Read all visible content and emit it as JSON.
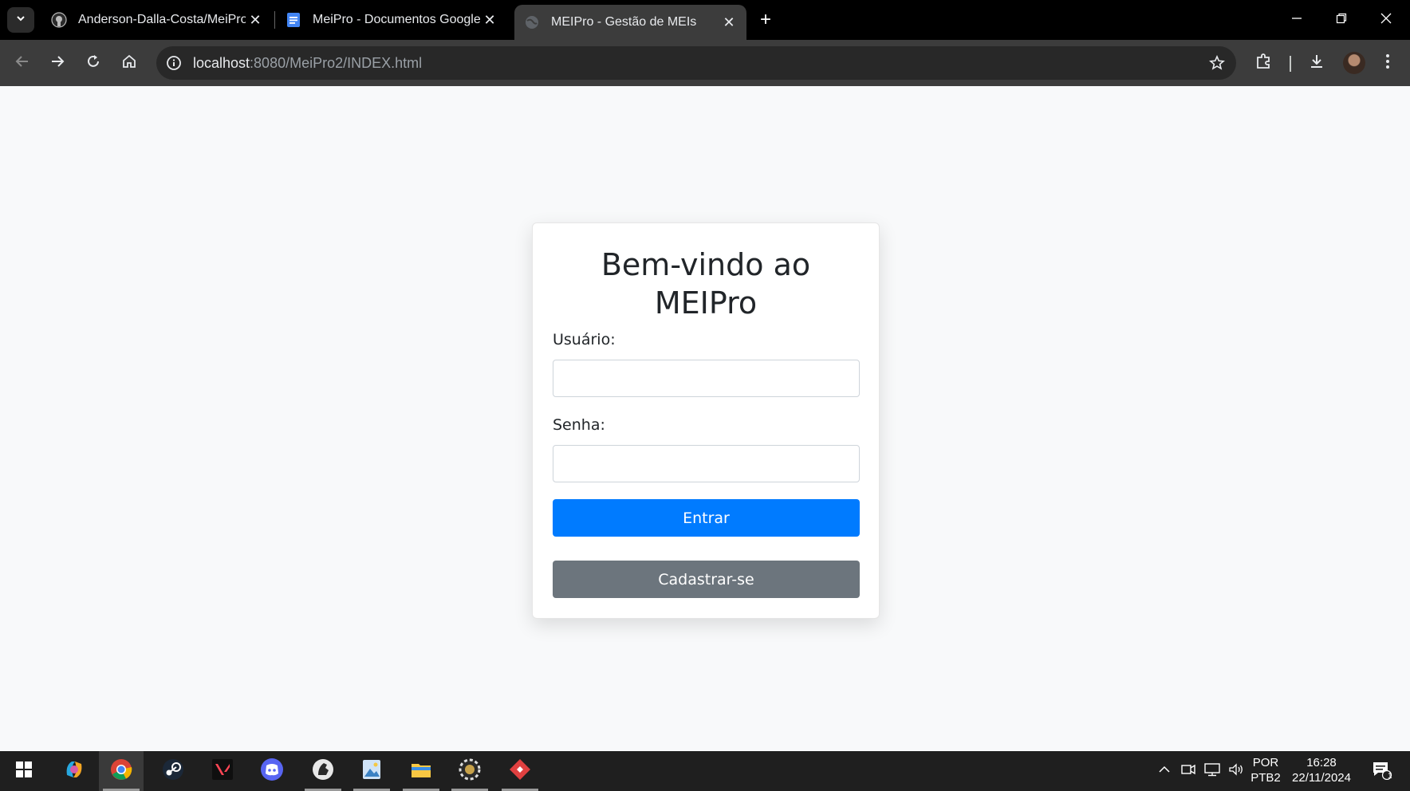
{
  "browser": {
    "tabs": [
      {
        "title": "Anderson-Dalla-Costa/MeiPro",
        "icon": "github-icon",
        "active": false
      },
      {
        "title": "MeiPro - Documentos Google",
        "icon": "google-docs-icon",
        "active": false
      },
      {
        "title": "MEIPro - Gestão de MEIs",
        "icon": "globe-icon",
        "active": true
      }
    ],
    "url_host": "localhost",
    "url_rest": ":8080/MeiPro2/INDEX.html"
  },
  "login": {
    "title": "Bem-vindo ao MEIPro",
    "username_label": "Usuário:",
    "username_value": "",
    "password_label": "Senha:",
    "password_value": "",
    "submit_label": "Entrar",
    "register_label": "Cadastrar-se"
  },
  "taskbar": {
    "apps": [
      "windows-start",
      "copilot",
      "chrome",
      "steam",
      "valorant",
      "discord",
      "app-horse",
      "notepad-image",
      "file-explorer",
      "settings-gear",
      "git-tool"
    ],
    "language_line1": "POR",
    "language_line2": "PTB2",
    "time": "16:28",
    "date": "22/11/2024",
    "notification_count": "1"
  },
  "colors": {
    "primary": "#007bff",
    "secondary": "#6c757d",
    "page_bg": "#f8f9fa"
  }
}
